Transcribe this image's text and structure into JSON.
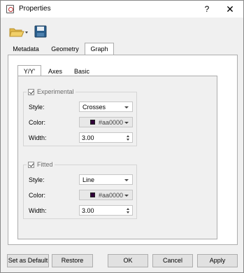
{
  "window": {
    "title": "Properties",
    "help_label": "?",
    "close_label": "✕"
  },
  "toolbar": {
    "open_icon": "folder-open-icon",
    "save_icon": "save-icon"
  },
  "tabs": {
    "main": [
      {
        "label": "Metadata"
      },
      {
        "label": "Geometry"
      },
      {
        "label": "Graph",
        "active": true
      }
    ],
    "sub": [
      {
        "label": "Y/Y'",
        "active": true
      },
      {
        "label": "Axes"
      },
      {
        "label": "Basic"
      }
    ]
  },
  "experimental": {
    "title": "Experimental",
    "checked": true,
    "style_label": "Style:",
    "style_value": "Crosses",
    "color_label": "Color:",
    "color_value": "#aa0000",
    "width_label": "Width:",
    "width_value": "3.00"
  },
  "fitted": {
    "title": "Fitted",
    "checked": true,
    "style_label": "Style:",
    "style_value": "Line",
    "color_label": "Color:",
    "color_value": "#aa0000",
    "width_label": "Width:",
    "width_value": "3.00"
  },
  "buttons": {
    "set_default": "Set as Default",
    "restore": "Restore",
    "ok": "OK",
    "cancel": "Cancel",
    "apply": "Apply"
  },
  "colors": {
    "swatch": "#31003a",
    "panel_border": "#adadad"
  }
}
